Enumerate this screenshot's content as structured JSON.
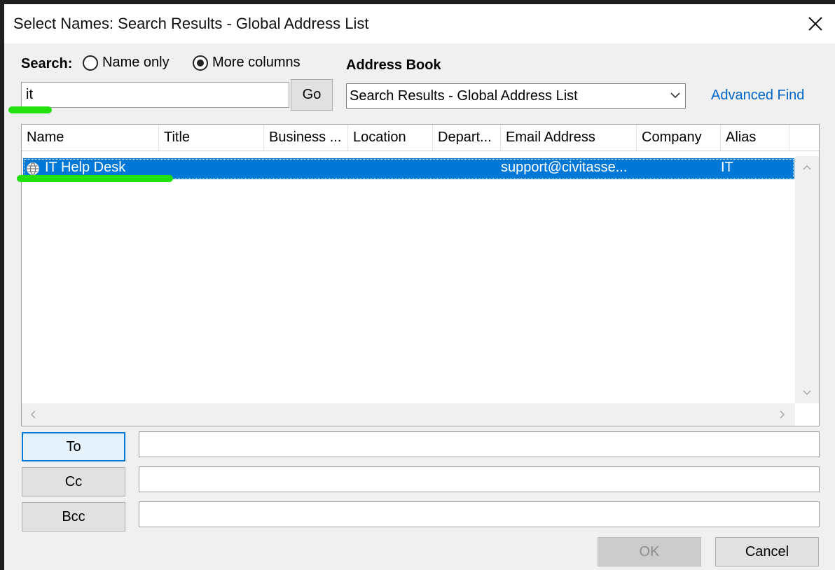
{
  "window": {
    "title": "Select Names: Search Results - Global Address List"
  },
  "search": {
    "label": "Search:",
    "value": "it",
    "options": [
      {
        "label": "Name only",
        "selected": false
      },
      {
        "label": "More columns",
        "selected": true
      }
    ],
    "go_label": "Go"
  },
  "address_book": {
    "label": "Address Book",
    "selected": "Search Results - Global Address List",
    "advanced_find": "Advanced Find"
  },
  "table": {
    "columns": [
      "Name",
      "Title",
      "Business ...",
      "Location",
      "Depart...",
      "Email Address",
      "Company",
      "Alias"
    ],
    "rows": [
      {
        "name": "IT Help Desk",
        "title": "",
        "business": "",
        "location": "",
        "department": "",
        "email": "support@civitasse...",
        "company": "",
        "alias": "IT",
        "selected": true
      }
    ]
  },
  "recipients": {
    "to_label": "To",
    "cc_label": "Cc",
    "bcc_label": "Bcc",
    "to_value": "",
    "cc_value": "",
    "bcc_value": ""
  },
  "buttons": {
    "ok": "OK",
    "cancel": "Cancel"
  },
  "colors": {
    "selection": "#0078d7",
    "link": "#0066cc",
    "highlight_marker": "#22e10f",
    "dialog_bg": "#f0f0f0"
  },
  "icons": {
    "close": "close-icon",
    "dropdown": "chevron-down-icon",
    "row": "globe-contact-icon"
  }
}
